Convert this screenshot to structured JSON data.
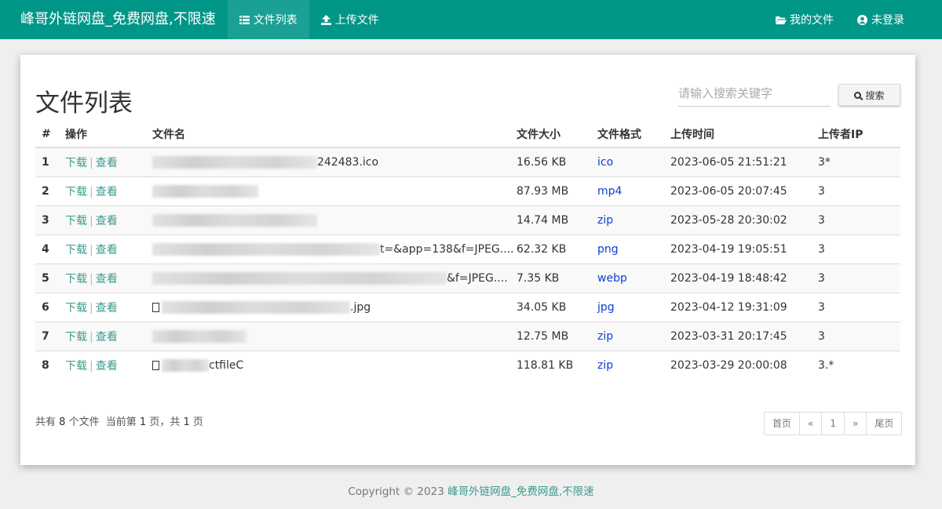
{
  "header": {
    "brand": "峰哥外链网盘_免费网盘,不限速",
    "nav": [
      {
        "label": "文件列表",
        "icon": "list-icon",
        "active": true
      },
      {
        "label": "上传文件",
        "icon": "upload-icon",
        "active": false
      }
    ],
    "right": [
      {
        "label": "我的文件",
        "icon": "folder-open-icon"
      },
      {
        "label": "未登录",
        "icon": "user-circle-icon"
      }
    ]
  },
  "main": {
    "title": "文件列表",
    "search": {
      "placeholder": "请输入搜索关键字",
      "button_label": "搜索",
      "button_icon": "search-icon"
    },
    "table": {
      "columns": [
        "#",
        "操作",
        "文件名",
        "文件大小",
        "文件格式",
        "上传时间",
        "上传者IP"
      ],
      "action_download": "下载",
      "action_view": "查看",
      "action_separator": "|",
      "rows": [
        {
          "num": "1",
          "name_tail": "242483.ico",
          "size": "16.56 KB",
          "format": "ico",
          "time": "2023-06-05 21:51:21",
          "ip": "3*"
        },
        {
          "num": "2",
          "name_tail": "",
          "size": "87.93 MB",
          "format": "mp4",
          "time": "2023-06-05 20:07:45",
          "ip": "3"
        },
        {
          "num": "3",
          "name_tail": "",
          "size": "14.74 MB",
          "format": "zip",
          "time": "2023-05-28 20:30:02",
          "ip": "3"
        },
        {
          "num": "4",
          "name_tail": "t=&app=138&f=JPEG....",
          "size": "62.32 KB",
          "format": "png",
          "time": "2023-04-19 19:05:51",
          "ip": "3"
        },
        {
          "num": "5",
          "name_tail": "&f=JPEG....",
          "size": "7.35 KB",
          "format": "webp",
          "time": "2023-04-19 18:48:42",
          "ip": "3"
        },
        {
          "num": "6",
          "name_tail": ".jpg",
          "size": "34.05 KB",
          "format": "jpg",
          "time": "2023-04-12 19:31:09",
          "ip": "3"
        },
        {
          "num": "7",
          "name_tail": "",
          "size": "12.75 MB",
          "format": "zip",
          "time": "2023-03-31 20:17:45",
          "ip": "3"
        },
        {
          "num": "8",
          "name_tail": "ctfileC",
          "size": "118.81 KB",
          "format": "zip",
          "time": "2023-03-29 20:00:08",
          "ip": "3.*"
        }
      ]
    },
    "summary": {
      "prefix": "共有",
      "count": "8",
      "count_suffix": "个文件",
      "current_prefix": "当前第",
      "current": "1",
      "current_suffix": "页，共",
      "total": "1",
      "total_suffix": "页"
    },
    "pager": [
      "首页",
      "«",
      "1",
      "»",
      "尾页"
    ]
  },
  "footer": {
    "text": "Copyright © 2023",
    "link": "峰哥外链网盘_免费网盘,不限速"
  }
}
